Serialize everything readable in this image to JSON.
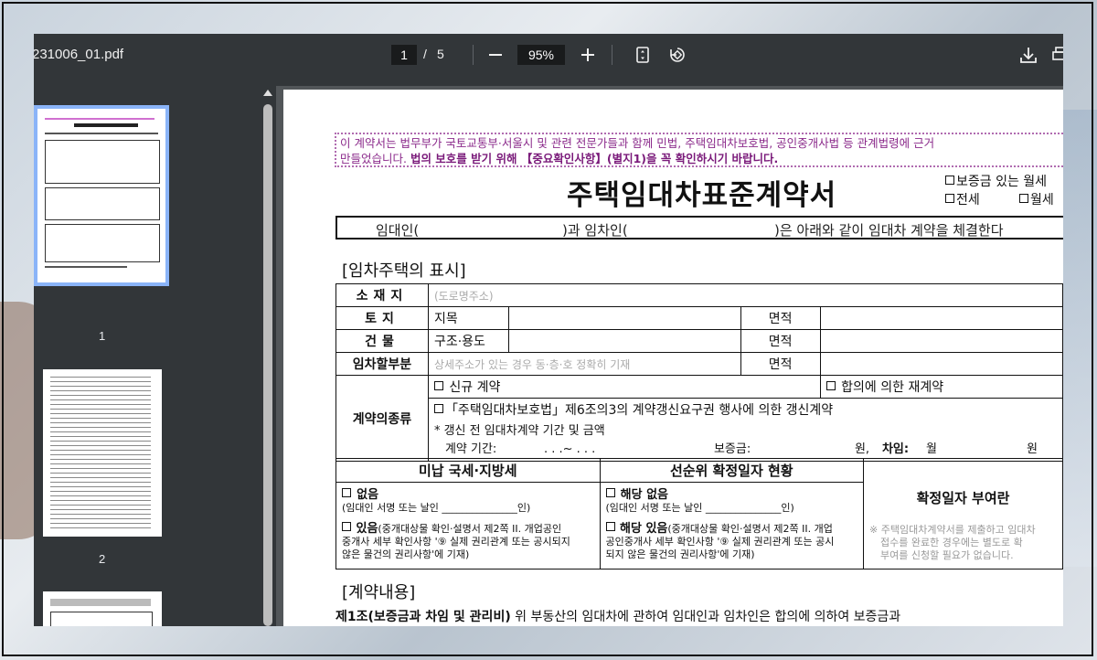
{
  "toolbar": {
    "filename": "231006_01.pdf",
    "current_page": "1",
    "page_sep": "/",
    "total_pages": "5",
    "zoom": "95%"
  },
  "thumbnails": [
    {
      "label": "1",
      "selected": true
    },
    {
      "label": "2",
      "selected": false
    },
    {
      "label": "",
      "selected": false
    }
  ],
  "document": {
    "notice_line1": "이 계약서는 법무부가 국토교통부·서울시 및 관련 전문가들과 함께 민법, 주택임대차보호법, 공인중개사법 등 관계법령에 근거",
    "notice_line2_a": "만들었습니다. ",
    "notice_line2_b": "법의 보호를 받기 위해 【중요확인사항】(별지1)을 꼭 확인하시기 바랍니다.",
    "title": "주택임대차표준계약서",
    "type_opt1": "보증금 있는 월세",
    "type_opt2": "전세",
    "type_opt3": "월세",
    "parties_a": "임대인(",
    "parties_b": ")과 임차인(",
    "parties_c": ")은 아래와 같이 임대차 계약을 체결한다",
    "section1": "[임차주택의 표시]",
    "rows": {
      "location_label": "소재지",
      "location_hint": "(도로명주소)",
      "land_label": "토지",
      "land_sub": "지목",
      "area_label": "면적",
      "building_label": "건물",
      "building_sub": "구조·용도",
      "area_label2": "면적",
      "part_label": "임차할부분",
      "part_hint": "상세주소가 있는 경우 동·층·호 정확히 기재",
      "area_label3": "면적",
      "contract_type_label": "계약의종류",
      "ct_new": "신규 계약",
      "ct_agreed": "합의에 의한 재계약",
      "ct_renewal": "「주택임대차보호법」제6조의3의 계약갱신요구권 행사에 의한 갱신계약",
      "ct_prev": "* 갱신 전 임대차계약 기간 및 금액",
      "ct_period": "계약 기간:",
      "ct_dots": ".    .    .~    .    .    .",
      "ct_deposit": "보증금:",
      "ct_won": "원,",
      "ct_rent": "차임:",
      "ct_month": "월",
      "ct_won2": "원"
    },
    "bottom": {
      "tax_head": "미납 국세·지방세",
      "tax_none": "없음",
      "tax_sign": "(임대인 서명 또는 날인 _______________인)",
      "tax_yes": "있음",
      "tax_yes_note": "(중개대상물 확인·설명서 제2쪽 II. 개업공인",
      "tax_yes_note2": "중개사 세부 확인사항 '⑨ 실제 권리관계 또는 공시되지",
      "tax_yes_note3": "않은 물건의 권리사항'에 기재)",
      "prior_head": "선순위 확정일자 현황",
      "prior_none": "해당 없음",
      "prior_sign": "(임대인 서명 또는 날인 _______________인)",
      "prior_yes": "해당 있음",
      "prior_yes_note": "(중개대상물 확인·설명서 제2쪽 II. 개업",
      "prior_yes_note2": "공인중개사 세부 확인사항 '⑨ 실제 권리관계 또는 공시",
      "prior_yes_note3": "되지 않은 물건의 권리사항'에 기재)",
      "date_head": "확정일자 부여란",
      "date_note1": "※ 주택임대차계약서를 제출하고 임대차",
      "date_note2": "접수를 완료한 경우에는 별도로 확",
      "date_note3": "부여를 신청할 필요가 없습니다."
    },
    "section2": "[계약내용]",
    "art1_title": "제1조(보증금과 차임 및 관리비)",
    "art1_text": " 위 부동산의 임대차에 관하여 임대인과 임차인은 합의에 의하여 보증금과"
  }
}
